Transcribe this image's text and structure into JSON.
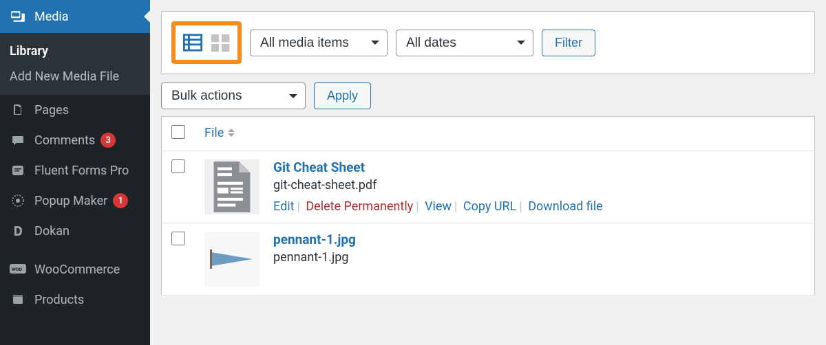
{
  "sidebar": {
    "active": {
      "label": "Media"
    },
    "subitems": [
      {
        "label": "Library",
        "current": true
      },
      {
        "label": "Add New Media File",
        "current": false
      }
    ],
    "items": [
      {
        "label": "Pages",
        "icon": "pages"
      },
      {
        "label": "Comments",
        "icon": "comments",
        "badge": "3"
      },
      {
        "label": "Fluent Forms Pro",
        "icon": "fluent"
      },
      {
        "label": "Popup Maker",
        "icon": "popup",
        "badge": "1"
      },
      {
        "label": "Dokan",
        "icon": "dokan"
      }
    ],
    "items2": [
      {
        "label": "WooCommerce",
        "icon": "woo"
      },
      {
        "label": "Products",
        "icon": "products"
      }
    ]
  },
  "filters": {
    "type": "All media items",
    "date": "All dates",
    "filter_btn": "Filter"
  },
  "bulk": {
    "select": "Bulk actions",
    "apply": "Apply"
  },
  "table": {
    "col_file": "File"
  },
  "rows": [
    {
      "title": "Git Cheat Sheet",
      "filename": "git-cheat-sheet.pdf",
      "type": "document",
      "actions": {
        "edit": "Edit",
        "delete": "Delete Permanently",
        "view": "View",
        "copy": "Copy URL",
        "download": "Download file"
      }
    },
    {
      "title": "pennant-1.jpg",
      "filename": "pennant-1.jpg",
      "type": "image"
    }
  ]
}
